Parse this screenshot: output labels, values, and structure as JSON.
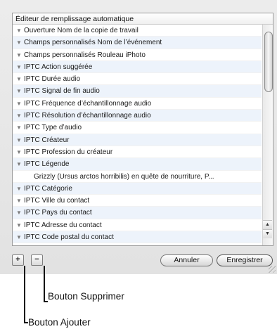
{
  "list": {
    "header": "Éditeur de remplissage automatique",
    "rows": [
      {
        "text": "Ouverture  Nom de la copie de travail",
        "child": false
      },
      {
        "text": "Champs personnalisés Nom de l’événement",
        "child": false
      },
      {
        "text": "Champs personnalisés Rouleau iPhoto",
        "child": false
      },
      {
        "text": "IPTC Action suggérée",
        "child": false
      },
      {
        "text": "IPTC Durée audio",
        "child": false
      },
      {
        "text": "IPTC Signal de fin audio",
        "child": false
      },
      {
        "text": "IPTC Fréquence d’échantillonnage audio",
        "child": false
      },
      {
        "text": "IPTC Résolution d’échantillonnage audio",
        "child": false
      },
      {
        "text": "IPTC Type d’audio",
        "child": false
      },
      {
        "text": "IPTC Créateur",
        "child": false
      },
      {
        "text": "IPTC Profession du créateur",
        "child": false
      },
      {
        "text": "IPTC Légende",
        "child": false
      },
      {
        "text": "Grizzly (Ursus arctos horribilis) en quête de nourriture, P...",
        "child": true
      },
      {
        "text": "IPTC Catégorie",
        "child": false
      },
      {
        "text": "IPTC Ville du contact",
        "child": false
      },
      {
        "text": "IPTC Pays du contact",
        "child": false
      },
      {
        "text": "IPTC Adresse du contact",
        "child": false
      },
      {
        "text": "IPTC Code postal du contact",
        "child": false
      }
    ],
    "disclosure_glyph": "▼"
  },
  "buttons": {
    "add": "+",
    "remove": "−",
    "cancel": "Annuler",
    "save": "Enregistrer"
  },
  "callouts": {
    "remove_label": "Bouton Supprimer",
    "add_label": "Bouton Ajouter"
  },
  "scroll": {
    "up": "▲",
    "down": "▼"
  },
  "colors": {
    "stripe": "#edf3fb",
    "panel": "#e6e6e6"
  }
}
